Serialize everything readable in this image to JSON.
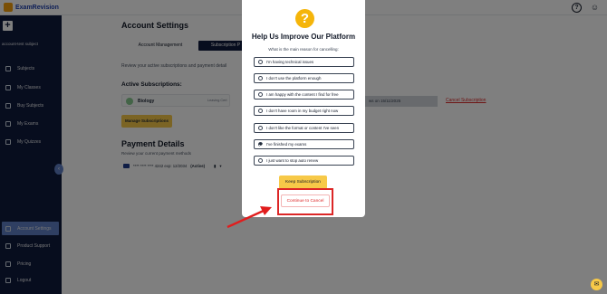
{
  "topbar": {
    "logo": "ExamRevision"
  },
  "sidebar": {
    "account_name": "account-test subject",
    "items": [
      {
        "label": "Subjects"
      },
      {
        "label": "My Classes"
      },
      {
        "label": "Buy Subjects"
      },
      {
        "label": "My Exams"
      },
      {
        "label": "My Quizzes"
      },
      {
        "label": "Account Settings"
      },
      {
        "label": "Product Support"
      },
      {
        "label": "Pricing"
      },
      {
        "label": "Logout"
      }
    ]
  },
  "main": {
    "title": "Account Settings",
    "tabs": [
      {
        "label": "Account Management"
      },
      {
        "label": "Subscription P"
      }
    ],
    "review_text": "Review your active subscriptions and payment detail",
    "active_subs_heading": "Active Subscriptions:",
    "subscription": {
      "name": "Biology",
      "badge": "Leaving Cert"
    },
    "renews_text": "ws on 15/11/2025",
    "cancel_link": "Cancel Subscription",
    "manage_button": "Manage Subscriptions",
    "payment_heading": "Payment Details",
    "payment_sub": "Review your current payment methods",
    "card": {
      "masked": "**** **** **** 4242 exp: 12/2034",
      "status": "(Active)"
    }
  },
  "modal": {
    "title": "Help Us Improve Our Platform",
    "subtitle": "What is the main reason for cancelling:",
    "options": [
      {
        "label": "I'm having technical issues",
        "selected": false
      },
      {
        "label": "I don't use the platform enough",
        "selected": false
      },
      {
        "label": "I am happy with the content I find for free",
        "selected": false
      },
      {
        "label": "I don't have room in my budget right now",
        "selected": false
      },
      {
        "label": "I don't like the format or content I've seen",
        "selected": false
      },
      {
        "label": "I've finished my exams",
        "selected": true
      },
      {
        "label": "I just want to stop auto renew",
        "selected": false
      }
    ],
    "keep_button": "Keep Subscription",
    "continue_button": "Continue to Cancel"
  },
  "colors": {
    "sidebar": "#0f1a3c",
    "accent": "#f7c948",
    "highlight": "#dc2626",
    "active_nav": "#5f7fc4"
  }
}
